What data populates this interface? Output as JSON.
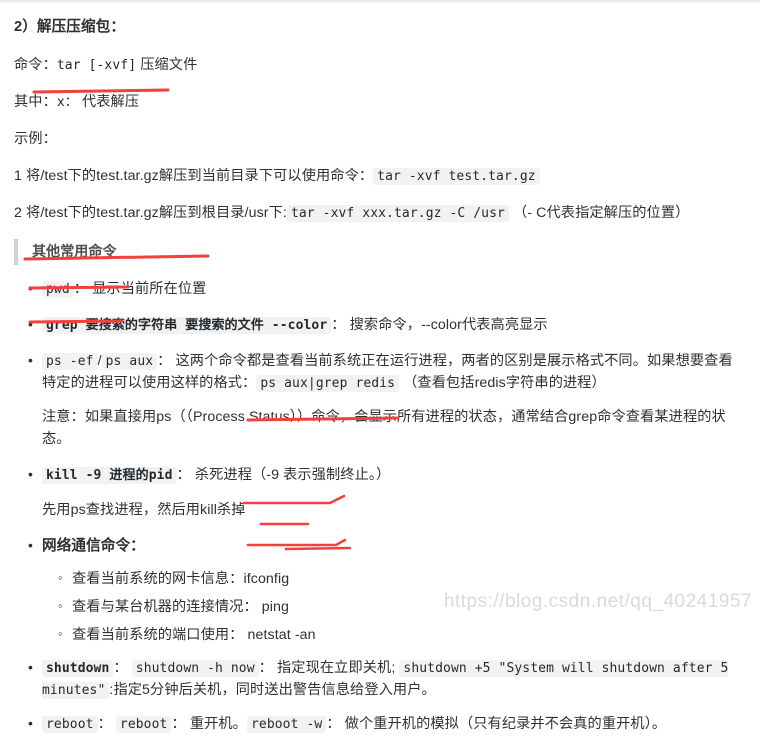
{
  "document": {
    "heading": "2）解压压缩包：",
    "command_line": {
      "label": "命令：",
      "code": "tar [-xvf]",
      "suffix": "压缩文件"
    },
    "where_line": {
      "label": "其中：",
      "code": "x：",
      "text": "代表解压"
    },
    "example_label": "示例：",
    "examples": [
      {
        "index": "1",
        "text": "将/test下的test.tar.gz解压到当前目录下可以使用命令：",
        "code": "tar -xvf test.tar.gz",
        "tail": ""
      },
      {
        "index": "2",
        "text": "将/test下的test.tar.gz解压到根目录/usr下:",
        "code": "tar -xvf xxx.tar.gz -C /usr",
        "tail": "（- C代表指定解压的位置）"
      }
    ],
    "quote_title": "其他常用命令",
    "commands": [
      {
        "name": "pwd-command",
        "code": "pwd",
        "sep": "：",
        "desc": "显示当前所在位置"
      },
      {
        "name": "grep-command",
        "code": "grep 要搜索的字符串 要搜索的文件 --color",
        "sep": "：",
        "desc": "搜索命令，--color代表高亮显示"
      }
    ],
    "ps_entry": {
      "code_a": "ps -ef",
      "slash": "/",
      "code_b": "ps aux",
      "sep": "：",
      "desc_1": "这两个命令都是查看当前系统正在运行进程，两者的区别是展示格式不同。如果想要查看特定的进程可以使用这样的格式：",
      "code_c": "ps aux|grep redis",
      "desc_2": "（查看包括redis字符串的进程）",
      "note": "注意：如果直接用ps（（Process Status））命令，会显示所有进程的状态，通常结合grep命令查看某进程的状态。"
    },
    "kill_entry": {
      "code": "kill -9 进程的pid",
      "sep": "：",
      "desc": "杀死进程（-9 表示强制终止。）",
      "sub": "先用ps查找进程，然后用kill杀掉"
    },
    "network_entry": {
      "title": "网络通信命令：",
      "items": [
        {
          "text": "查看当前系统的网卡信息：",
          "cmd": "ifconfig"
        },
        {
          "text": "查看与某台机器的连接情况：",
          "cmd": "ping"
        },
        {
          "text": "查看当前系统的端口使用：",
          "cmd": "netstat -an"
        }
      ]
    },
    "shutdown_entry": {
      "code_head": "shutdown",
      "sep1": "：",
      "code_a": "shutdown -h now",
      "sep2": "：",
      "text_a": "指定现在立即关机;",
      "code_b": "shutdown +5 \"System will shutdown after 5 minutes\"",
      "text_b": ":指定5分钟后关机，同时送出警告信息给登入用户。"
    },
    "reboot_entry": {
      "code_head": "reboot",
      "sep1": "：",
      "code_a": "reboot",
      "sep2": "：",
      "text_a": "重开机。",
      "code_b": "reboot -w",
      "sep3": "：",
      "text_b": "做个重开机的模拟（只有纪录并不会真的重开机）。"
    },
    "watermark": "https://blog.csdn.net/qq_40241957"
  },
  "colors": {
    "marker_red": "#f4403a",
    "text": "#2f3032",
    "code_bg": "#f2f2f2",
    "quote_border": "#d0d0d0",
    "watermark": "#d6dbe0"
  }
}
